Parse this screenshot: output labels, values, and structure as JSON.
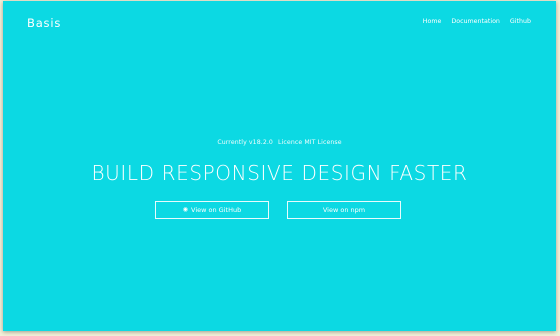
{
  "brand": {
    "name": "Basis"
  },
  "nav": {
    "items": [
      {
        "label": "Home"
      },
      {
        "label": "Documentation"
      },
      {
        "label": "Github"
      }
    ]
  },
  "hero": {
    "version_text": "Currently v18.2.0",
    "license_text": "Licence MIT License",
    "headline": "BUILD RESPONSIVE DESIGN FASTER",
    "buttons": {
      "github_label": "View on GitHub",
      "npm_label": "View on npm"
    }
  },
  "icons": {
    "github": "github-icon"
  },
  "colors": {
    "background": "#0cd9e3",
    "text": "#ffffff"
  }
}
